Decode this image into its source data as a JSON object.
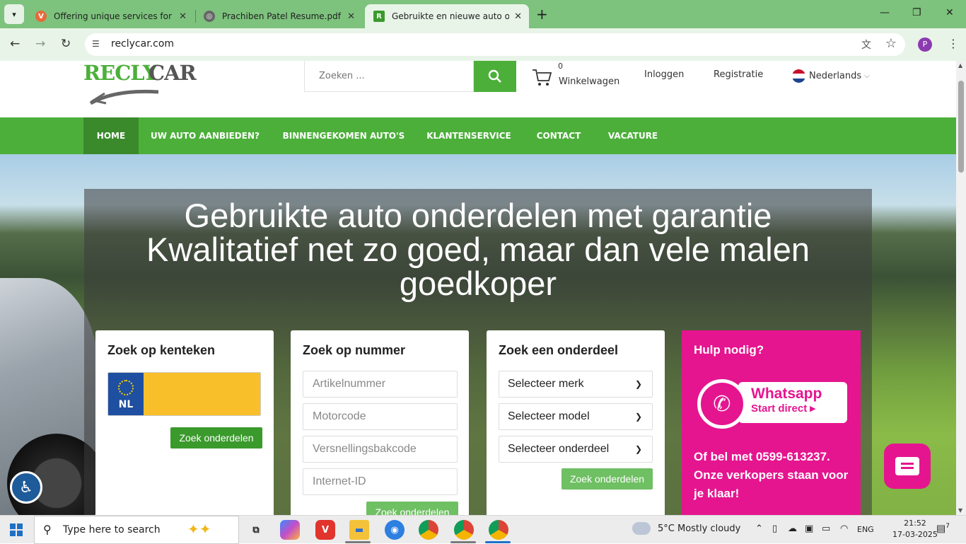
{
  "browser": {
    "tabs": [
      {
        "title": "Offering unique services for tho",
        "favicon_color": "#e8693a"
      },
      {
        "title": "Prachiben Patel Resume.pdf",
        "favicon_color": "#666666"
      },
      {
        "title": "Gebruikte en nieuwe auto onde",
        "favicon_color": "#3a9a2c"
      }
    ],
    "url": "reclycar.com",
    "profile_initial": "P"
  },
  "site": {
    "logo": {
      "part1": "RECLY",
      "part2": "CAR"
    },
    "search_placeholder": "Zoeken ...",
    "cart": {
      "count": "0",
      "label": "Winkelwagen"
    },
    "login": "Inloggen",
    "register": "Registratie",
    "language": "Nederlands",
    "nav": [
      {
        "label": "HOME"
      },
      {
        "label": "UW AUTO AANBIEDEN?"
      },
      {
        "label": "BINNENGEKOMEN AUTO'S"
      },
      {
        "label": "KLANTENSERVICE"
      },
      {
        "label": "CONTACT"
      },
      {
        "label": "VACATURE"
      }
    ],
    "hero": {
      "line1": "Gebruikte auto onderdelen met garantie",
      "line2": "Kwalitatief net zo goed, maar dan vele malen",
      "line3": "goedkoper"
    },
    "kenteken": {
      "title": "Zoek op kenteken",
      "country": "NL",
      "button": "Zoek onderdelen"
    },
    "nummer": {
      "title": "Zoek op nummer",
      "fields": [
        "Artikelnummer",
        "Motorcode",
        "Versnellingsbakcode",
        "Internet-ID"
      ],
      "button": "Zoek onderdelen"
    },
    "onderdeel": {
      "title": "Zoek een onderdeel",
      "selects": [
        "Selecteer merk",
        "Selecteer model",
        "Selecteer onderdeel"
      ],
      "button": "Zoek onderdelen"
    },
    "help": {
      "title": "Hulp nodig?",
      "whatsapp_title": "Whatsapp",
      "whatsapp_sub": "Start direct",
      "call_text": "Of bel met 0599-613237. Onze verkopers staan voor je klaar!"
    }
  },
  "taskbar": {
    "search_text": "Type here to search",
    "weather": "5°C  Mostly cloudy",
    "lang": "ENG",
    "time": "21:52",
    "date": "17-03-2025",
    "notifications": "7"
  },
  "colors": {
    "brand_green": "#4caf3a",
    "brand_pink": "#e5158f"
  }
}
